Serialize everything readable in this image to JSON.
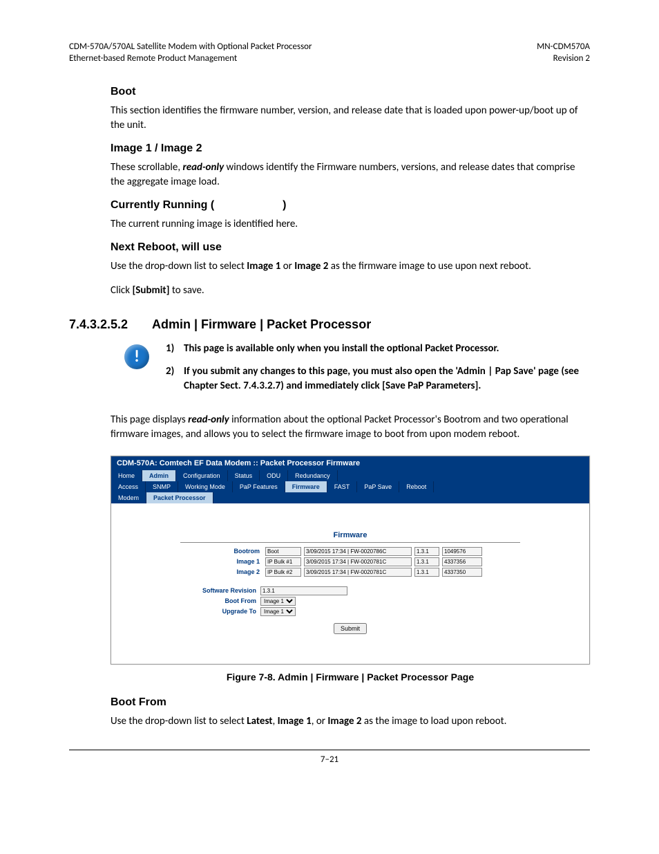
{
  "header": {
    "left1": "CDM-570A/570AL Satellite Modem with Optional Packet Processor",
    "left2": "Ethernet-based Remote Product Management",
    "right1": "MN-CDM570A",
    "right2": "Revision 2"
  },
  "boot": {
    "title": "Boot",
    "text": "This section identifies the firmware number, version, and release date that is loaded upon power-up/boot up of the unit."
  },
  "image12": {
    "title": "Image 1 / Image 2",
    "prefix": "These scrollable, ",
    "ro": "read-only",
    "suffix": " windows identify the Firmware numbers, versions, and release dates that comprise the aggregate image load."
  },
  "currRun": {
    "title_a": "Currently Running (",
    "title_b": ")",
    "text": "The current running image is identified here."
  },
  "nextReboot": {
    "title": "Next Reboot, will use",
    "p_a": "Use the drop-down list to select ",
    "img1": "Image 1",
    "p_or": " or ",
    "img2": "Image 2",
    "p_b": " as the firmware image to use upon next reboot.",
    "click": "Click ",
    "submit": "[Submit]",
    "save": " to save."
  },
  "section": {
    "num": "7.4.3.2.5.2",
    "title": "Admin | Firmware | Packet Processor"
  },
  "notes": {
    "n1": "This page is available only when you install the optional Packet Processor.",
    "n2": "If you submit any changes to this page, you must also open the 'Admin | Pap Save' page (see Chapter Sect. 7.4.3.2.7) and immediately click [Save PaP Parameters]."
  },
  "desc": {
    "a": "This page displays ",
    "ro": "read-only",
    "b": " information about the optional Packet Processor's Bootrom and two operational firmware images, and allows you to select the firmware image to boot from upon modem reboot."
  },
  "ss": {
    "title": "CDM-570A: Comtech EF Data Modem :: Packet Processor Firmware",
    "row1": [
      "Home",
      "Admin",
      "Configuration",
      "Status",
      "ODU",
      "Redundancy"
    ],
    "row2": [
      "Access",
      "SNMP",
      "Working Mode",
      "PaP Features",
      "Firmware",
      "FAST",
      "PaP Save",
      "Reboot"
    ],
    "row3": [
      "Modem",
      "Packet Processor"
    ],
    "fw_heading": "Firmware",
    "bootrom": {
      "lbl": "Bootrom",
      "f1": "Boot",
      "f2": "3/09/2015 17:34 | FW-0020786C",
      "f3": "1.3.1",
      "f4": "1049576"
    },
    "image1": {
      "lbl": "Image 1",
      "f1": "IP Bulk #1",
      "f2": "3/09/2015 17:34 | FW-0020781C",
      "f3": "1.3.1",
      "f4": "4337356"
    },
    "image2": {
      "lbl": "Image 2",
      "f1": "IP Bulk #2",
      "f2": "3/09/2015 17:34 | FW-0020781C",
      "f3": "1.3.1",
      "f4": "4337350"
    },
    "swrev_lbl": "Software Revision",
    "swrev_val": "1.3.1",
    "bootfrom_lbl": "Boot From",
    "bootfrom_val": "Image 1",
    "upgrade_lbl": "Upgrade To",
    "upgrade_val": "Image 1",
    "submit": "Submit"
  },
  "figure": "Figure 7-8. Admin | Firmware | Packet Processor Page",
  "bootFrom": {
    "title": "Boot From",
    "a": "Use the drop-down list to select ",
    "latest": "Latest",
    "c1": ", ",
    "img1": "Image 1",
    "c2": ", or ",
    "img2": "Image 2",
    "b": " as the image to load upon reboot."
  },
  "footer": "7–21"
}
